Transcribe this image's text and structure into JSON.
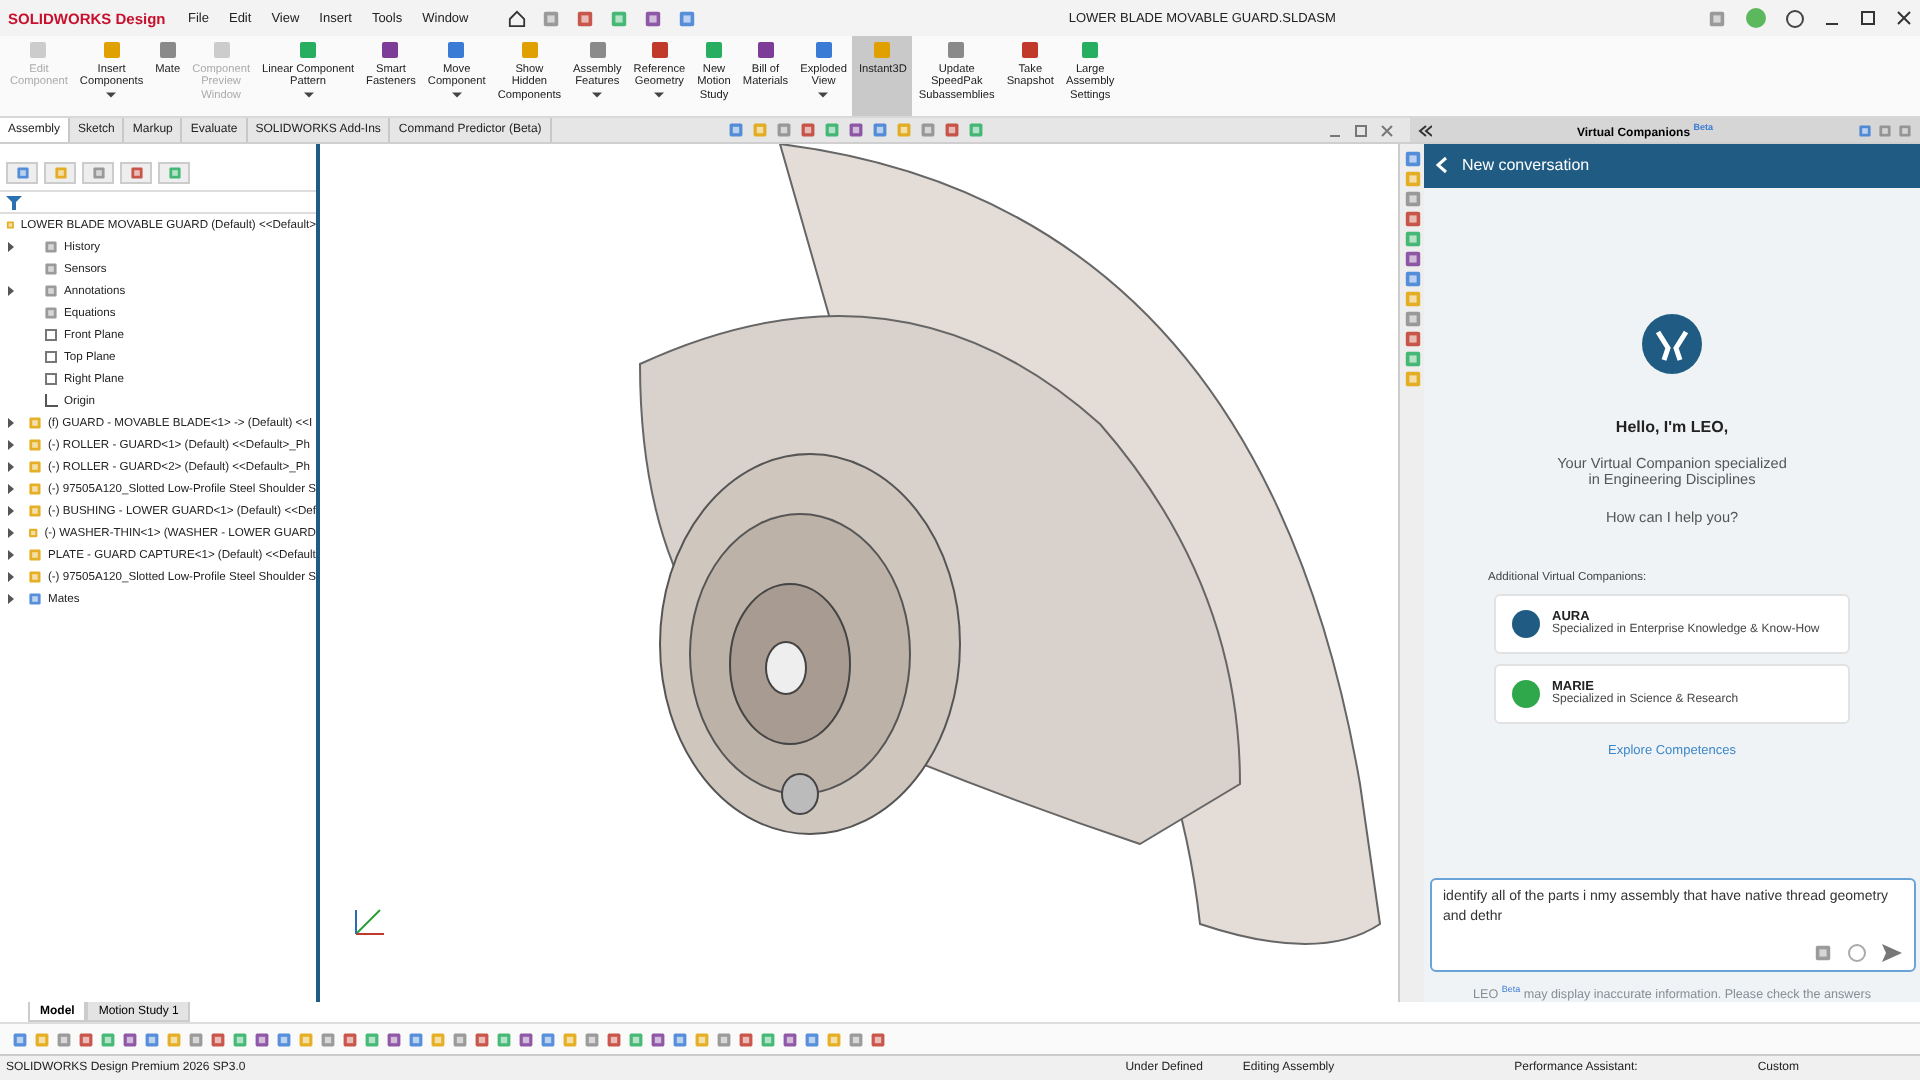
{
  "title_bar": {
    "brand": "SOLIDWORKS Design",
    "menus": [
      "File",
      "Edit",
      "View",
      "Insert",
      "Tools",
      "Window"
    ],
    "document": "LOWER BLADE MOVABLE GUARD.SLDASM"
  },
  "ribbon": [
    {
      "label": "Edit\nComponent",
      "disabled": true,
      "dropdown": false,
      "selected": false
    },
    {
      "label": "Insert\nComponents",
      "disabled": false,
      "dropdown": true,
      "selected": false
    },
    {
      "label": "Mate",
      "disabled": false,
      "dropdown": false,
      "selected": false
    },
    {
      "label": "Component\nPreview\nWindow",
      "disabled": true,
      "dropdown": false,
      "selected": false
    },
    {
      "label": "Linear Component\nPattern",
      "disabled": false,
      "dropdown": true,
      "selected": false
    },
    {
      "label": "Smart\nFasteners",
      "disabled": false,
      "dropdown": false,
      "selected": false
    },
    {
      "label": "Move\nComponent",
      "disabled": false,
      "dropdown": true,
      "selected": false
    },
    {
      "label": "Show\nHidden\nComponents",
      "disabled": false,
      "dropdown": false,
      "selected": false
    },
    {
      "label": "Assembly\nFeatures",
      "disabled": false,
      "dropdown": true,
      "selected": false
    },
    {
      "label": "Reference\nGeometry",
      "disabled": false,
      "dropdown": true,
      "selected": false
    },
    {
      "label": "New\nMotion\nStudy",
      "disabled": false,
      "dropdown": false,
      "selected": false
    },
    {
      "label": "Bill of\nMaterials",
      "disabled": false,
      "dropdown": false,
      "selected": false
    },
    {
      "label": "Exploded\nView",
      "disabled": false,
      "dropdown": true,
      "selected": false
    },
    {
      "label": "Instant3D",
      "disabled": false,
      "dropdown": false,
      "selected": true
    },
    {
      "label": "Update\nSpeedPak\nSubassemblies",
      "disabled": false,
      "dropdown": false,
      "selected": false
    },
    {
      "label": "Take\nSnapshot",
      "disabled": false,
      "dropdown": false,
      "selected": false
    },
    {
      "label": "Large\nAssembly\nSettings",
      "disabled": false,
      "dropdown": false,
      "selected": false
    }
  ],
  "command_tabs": [
    {
      "label": "Assembly",
      "selected": true
    },
    {
      "label": "Sketch",
      "selected": false
    },
    {
      "label": "Markup",
      "selected": false
    },
    {
      "label": "Evaluate",
      "selected": false
    },
    {
      "label": "SOLIDWORKS Add-Ins",
      "selected": false
    },
    {
      "label": "Command Predictor (Beta)",
      "selected": false
    }
  ],
  "feature_tree": {
    "root": "LOWER BLADE MOVABLE GUARD (Default) <<Default>",
    "items": [
      {
        "label": "History",
        "kind": "folder",
        "expandable": true
      },
      {
        "label": "Sensors",
        "kind": "folder",
        "expandable": false
      },
      {
        "label": "Annotations",
        "kind": "folder",
        "expandable": true
      },
      {
        "label": "Equations",
        "kind": "folder",
        "expandable": false
      },
      {
        "label": "Front Plane",
        "kind": "plane",
        "expandable": false
      },
      {
        "label": "Top Plane",
        "kind": "plane",
        "expandable": false
      },
      {
        "label": "Right Plane",
        "kind": "plane",
        "expandable": false
      },
      {
        "label": "Origin",
        "kind": "origin",
        "expandable": false
      },
      {
        "label": "(f) GUARD - MOVABLE BLADE<1> -> (Default) <<I",
        "kind": "part",
        "expandable": true
      },
      {
        "label": "(-) ROLLER - GUARD<1> (Default) <<Default>_Ph",
        "kind": "part",
        "expandable": true
      },
      {
        "label": "(-) ROLLER - GUARD<2> (Default) <<Default>_Ph",
        "kind": "part",
        "expandable": true
      },
      {
        "label": "(-) 97505A120_Slotted Low-Profile Steel Shoulder S",
        "kind": "part",
        "expandable": true
      },
      {
        "label": "(-) BUSHING - LOWER GUARD<1> (Default) <<Def",
        "kind": "part",
        "expandable": true
      },
      {
        "label": "(-) WASHER-THIN<1> (WASHER - LOWER GUARD",
        "kind": "part",
        "expandable": true
      },
      {
        "label": "PLATE - GUARD CAPTURE<1> (Default) <<Default",
        "kind": "part",
        "expandable": true
      },
      {
        "label": "(-) 97505A120_Slotted Low-Profile Steel Shoulder S",
        "kind": "part",
        "expandable": true
      },
      {
        "label": "Mates",
        "kind": "mates",
        "expandable": true
      }
    ]
  },
  "companion_panel": {
    "title": "Virtual Companions",
    "title_badge": "Beta",
    "header": "New conversation",
    "greeting": "Hello, I'm LEO,",
    "intro": "Your Virtual Companion specialized\nin Engineering Disciplines",
    "question": "How can I help you?",
    "others_label": "Additional Virtual Companions:",
    "companions": [
      {
        "name": "AURA",
        "description": "Specialized in Enterprise Knowledge & Know-How",
        "color": "#1f5b82"
      },
      {
        "name": "MARIE",
        "description": "Specialized in Science & Research",
        "color": "#2ea84a"
      }
    ],
    "link": "Explore Competences",
    "input_value": "identify all of the parts i nmy assembly that have native thread geometry and dethr",
    "disclaimer_name": "LEO",
    "disclaimer_badge": "Beta",
    "disclaimer": "may display inaccurate information. Please check the answers"
  },
  "bottom_tabs": [
    {
      "label": "Model",
      "selected": true
    },
    {
      "label": "Motion Study 1",
      "selected": false
    }
  ],
  "status_bar": {
    "product": "SOLIDWORKS Design Premium 2026 SP3.0",
    "state": "Under Defined",
    "mode": "Editing Assembly",
    "assistant": "Performance Assistant:",
    "units": "Custom"
  }
}
